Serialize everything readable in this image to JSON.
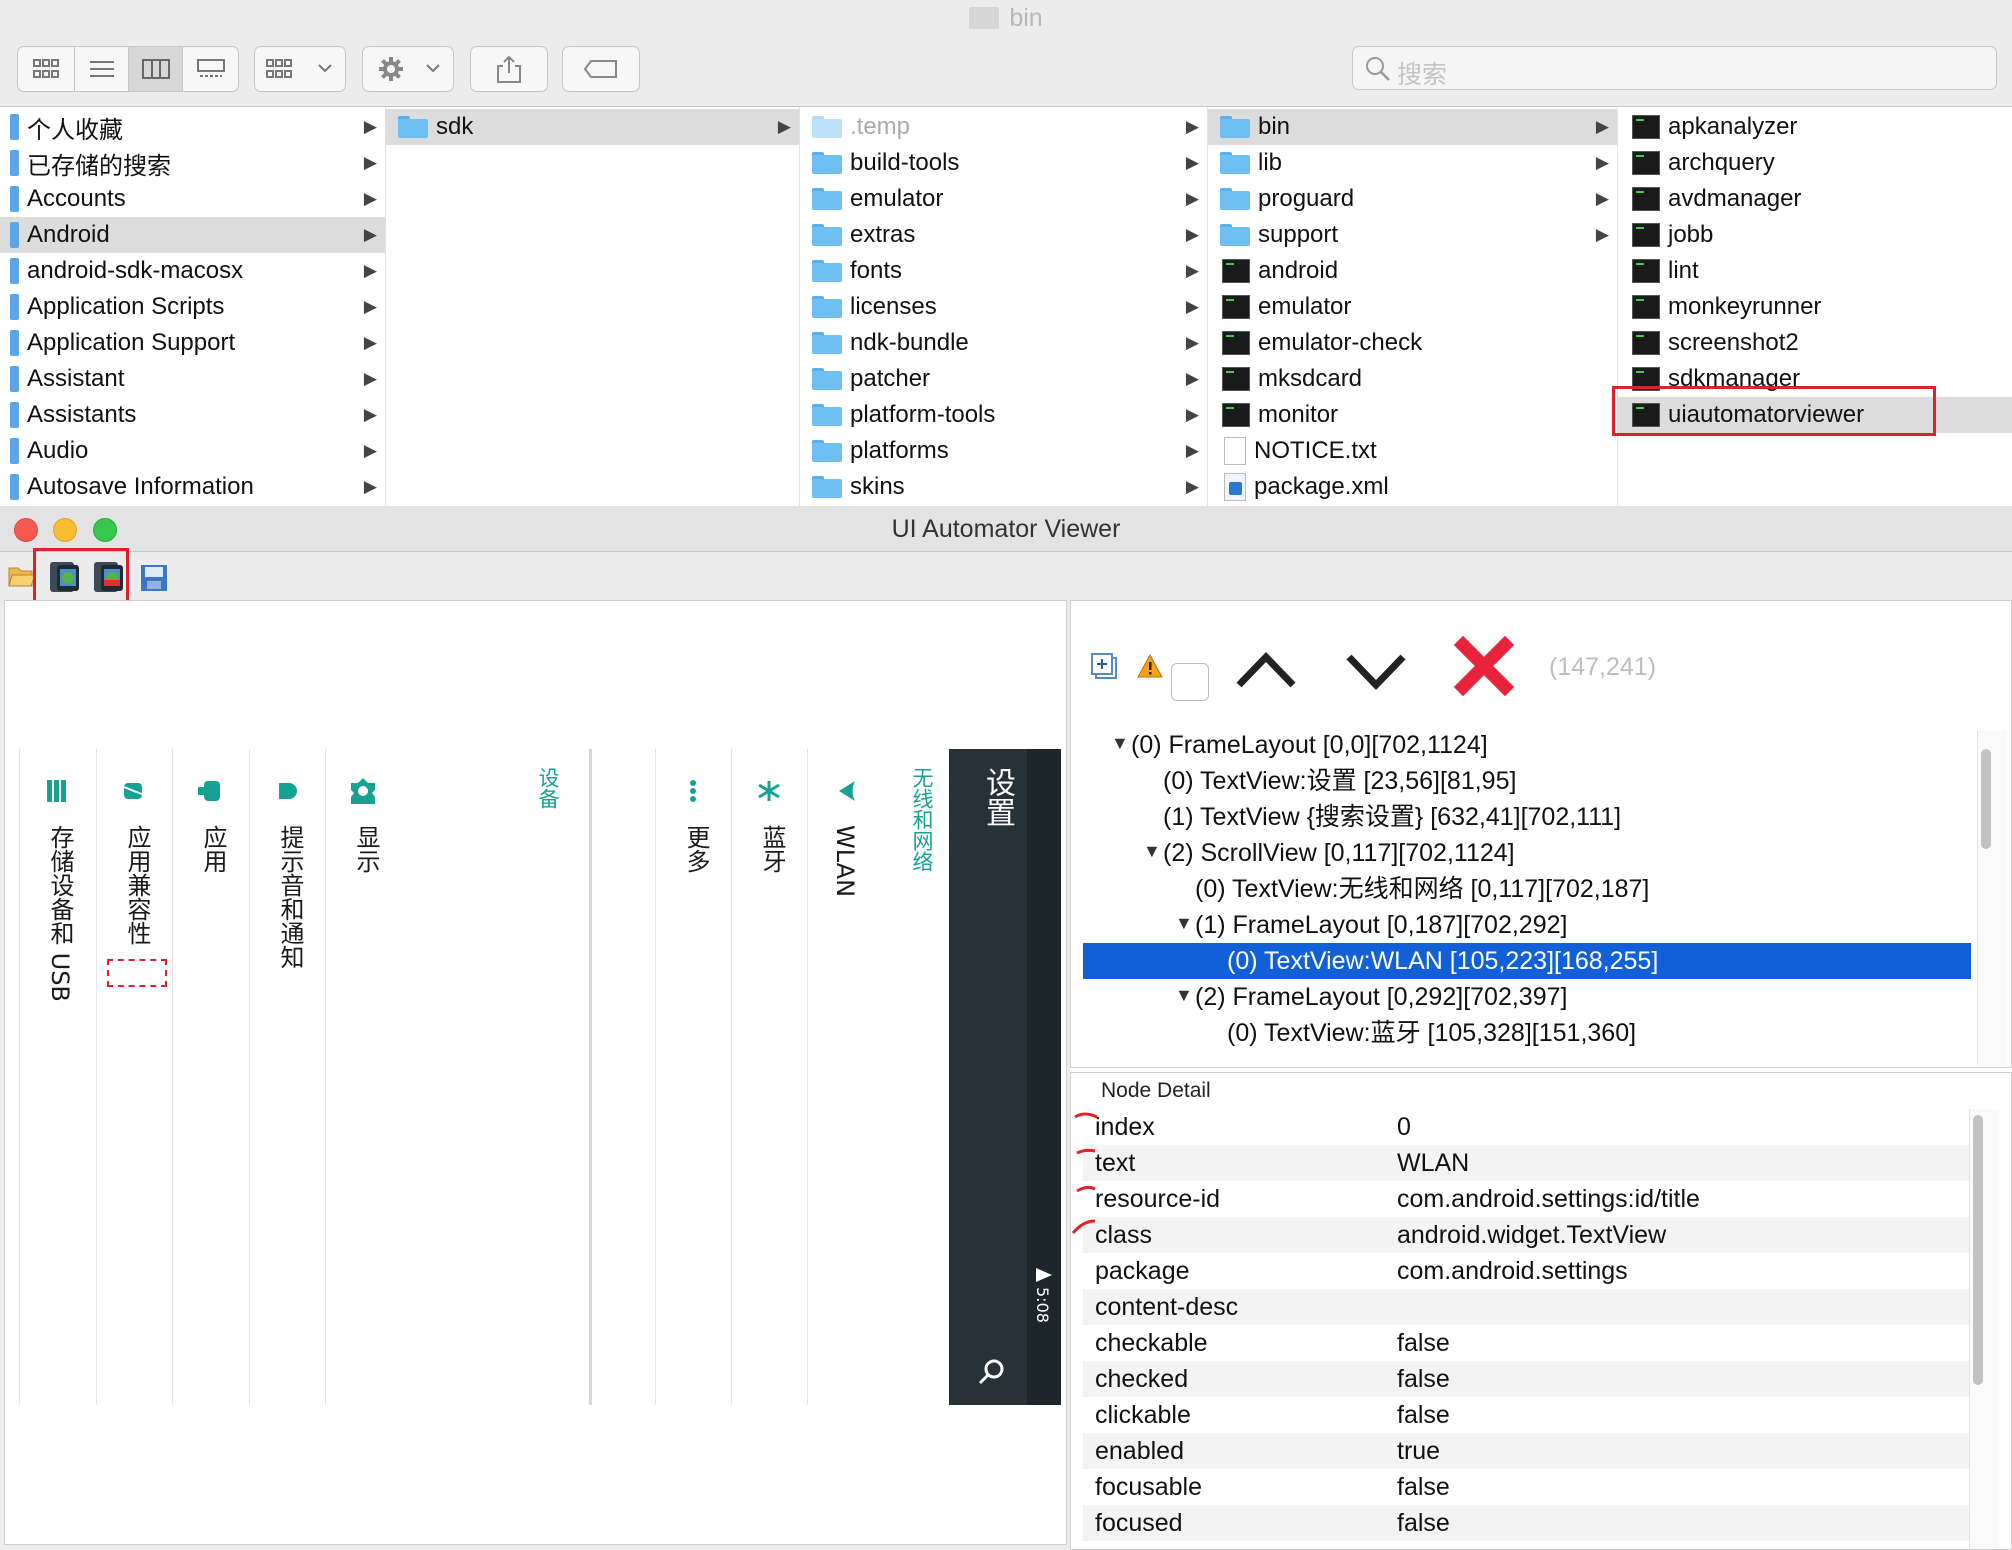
{
  "finder": {
    "title": "bin",
    "search_placeholder": "搜索",
    "sidebar": [
      {
        "label": "个人收藏"
      },
      {
        "label": "已存储的搜索"
      },
      {
        "label": "Accounts"
      },
      {
        "label": "Android",
        "selected": true
      },
      {
        "label": "android-sdk-macosx"
      },
      {
        "label": "Application Scripts"
      },
      {
        "label": "Application Support"
      },
      {
        "label": "Assistant"
      },
      {
        "label": "Assistants"
      },
      {
        "label": "Audio"
      },
      {
        "label": "Autosave Information"
      }
    ],
    "column2": [
      {
        "label": "sdk",
        "selected": true
      }
    ],
    "column3": [
      {
        "label": ".temp"
      },
      {
        "label": "build-tools"
      },
      {
        "label": "emulator"
      },
      {
        "label": "extras"
      },
      {
        "label": "fonts"
      },
      {
        "label": "licenses"
      },
      {
        "label": "ndk-bundle"
      },
      {
        "label": "patcher"
      },
      {
        "label": "platform-tools"
      },
      {
        "label": "platforms"
      },
      {
        "label": "skins"
      }
    ],
    "column4": [
      {
        "label": "bin",
        "selected": true
      },
      {
        "label": "lib"
      },
      {
        "label": "proguard"
      },
      {
        "label": "support"
      },
      {
        "label": "android"
      },
      {
        "label": "emulator"
      },
      {
        "label": "emulator-check"
      },
      {
        "label": "mksdcard"
      },
      {
        "label": "monitor"
      },
      {
        "label": "NOTICE.txt"
      },
      {
        "label": "package.xml"
      }
    ],
    "column5": [
      {
        "label": "apkanalyzer"
      },
      {
        "label": "archquery"
      },
      {
        "label": "avdmanager"
      },
      {
        "label": "jobb"
      },
      {
        "label": "lint"
      },
      {
        "label": "monkeyrunner"
      },
      {
        "label": "screenshot2"
      },
      {
        "label": "sdkmanager"
      },
      {
        "label": "uiautomatorviewer",
        "selected": true
      }
    ]
  },
  "viewer": {
    "title": "UI Automator Viewer",
    "coords": "(147,241)",
    "device": {
      "toolbar_title": "设置",
      "status_time": "5:08",
      "section1_header": "无线和网络",
      "section1_items": [
        "WLAN",
        "蓝牙",
        "更多"
      ],
      "section2_header": "设备",
      "section2_items": [
        "显示",
        "提示音和通知",
        "应用",
        "应用兼容性",
        "存储设备和 USB"
      ]
    },
    "tree": [
      {
        "text": "(0) FrameLayout [0,0][702,1124]",
        "expanded": true
      },
      {
        "text": "(0) TextView:设置 [23,56][81,95]"
      },
      {
        "text": "(1) TextView {搜索设置} [632,41][702,111]"
      },
      {
        "text": "(2) ScrollView [0,117][702,1124]",
        "expanded": true
      },
      {
        "text": "(0) TextView:无线和网络 [0,117][702,187]"
      },
      {
        "text": "(1) FrameLayout [0,187][702,292]",
        "expanded": true
      },
      {
        "text": "(0) TextView:WLAN [105,223][168,255]",
        "selected": true
      },
      {
        "text": "(2) FrameLayout [0,292][702,397]",
        "expanded": true
      },
      {
        "text": "(0) TextView:蓝牙 [105,328][151,360]"
      }
    ],
    "node_detail": {
      "title": "Node Detail",
      "rows": [
        {
          "key": "index",
          "value": "0"
        },
        {
          "key": "text",
          "value": "WLAN"
        },
        {
          "key": "resource-id",
          "value": "com.android.settings:id/title"
        },
        {
          "key": "class",
          "value": "android.widget.TextView"
        },
        {
          "key": "package",
          "value": "com.android.settings"
        },
        {
          "key": "content-desc",
          "value": ""
        },
        {
          "key": "checkable",
          "value": "false"
        },
        {
          "key": "checked",
          "value": "false"
        },
        {
          "key": "clickable",
          "value": "false"
        },
        {
          "key": "enabled",
          "value": "true"
        },
        {
          "key": "focusable",
          "value": "false"
        },
        {
          "key": "focused",
          "value": "false"
        }
      ]
    }
  },
  "colors": {
    "accent": "#1160d8",
    "teal": "#17a193",
    "annotation_red": "#e0202a",
    "device_bar": "#263238"
  }
}
